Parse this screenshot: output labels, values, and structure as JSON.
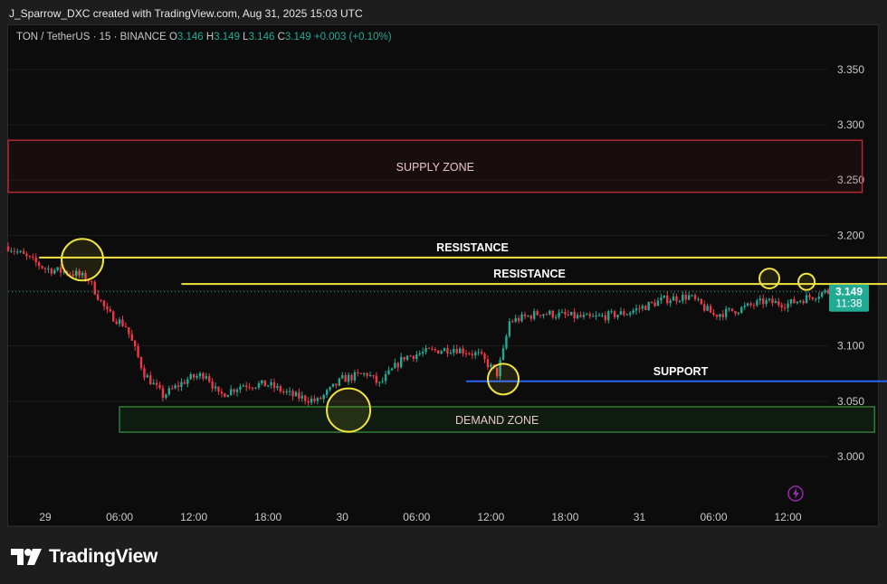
{
  "credit": "J_Sparrow_DXC created with TradingView.com, Aug 31, 2025 15:03 UTC",
  "legend": {
    "symbol": "TON / TetherUS · 15 · BINANCE",
    "o_label": "O",
    "o": "3.146",
    "h_label": "H",
    "h": "3.149",
    "l_label": "L",
    "l": "3.146",
    "c_label": "C",
    "c": "3.149",
    "change": "+0.003 (+0.10%)"
  },
  "price_tag": {
    "price": "3.149",
    "countdown": "11:38"
  },
  "brand": "TradingView",
  "colors": {
    "up": "#22ab94",
    "down": "#f23645",
    "resistance": "#f0e442",
    "support": "#2962ff",
    "supply": "#b22833",
    "demand": "#2e7d32",
    "tag": "#22ab94"
  },
  "chart_data": {
    "type": "candlestick",
    "y_ticks": [
      "3.350",
      "3.300",
      "3.250",
      "3.200",
      "3.150",
      "3.100",
      "3.050",
      "3.000"
    ],
    "y_tick_values": [
      3.35,
      3.3,
      3.25,
      3.2,
      3.15,
      3.1,
      3.05,
      3.0
    ],
    "ylim": [
      2.955,
      3.39
    ],
    "x_ticks": [
      "29",
      "06:00",
      "12:00",
      "18:00",
      "30",
      "06:00",
      "12:00",
      "18:00",
      "31",
      "06:00",
      "12:00"
    ],
    "x_start": "2025-08-28 21:00 UTC",
    "x_end": "2025-08-31 15:15 UTC",
    "interval": "15m",
    "trend_path": [
      {
        "t": "2025-08-28 21:00",
        "p": 3.19
      },
      {
        "t": "2025-08-29 00:00",
        "p": 3.17
      },
      {
        "t": "2025-08-29 02:30",
        "p": 3.165
      },
      {
        "t": "2025-08-29 03:30",
        "p": 3.16
      },
      {
        "t": "2025-08-29 05:00",
        "p": 3.13
      },
      {
        "t": "2025-08-29 06:30",
        "p": 3.118
      },
      {
        "t": "2025-08-29 08:00",
        "p": 3.075
      },
      {
        "t": "2025-08-29 09:30",
        "p": 3.055
      },
      {
        "t": "2025-08-29 11:30",
        "p": 3.07
      },
      {
        "t": "2025-08-29 13:00",
        "p": 3.075
      },
      {
        "t": "2025-08-29 14:00",
        "p": 3.055
      },
      {
        "t": "2025-08-29 16:00",
        "p": 3.065
      },
      {
        "t": "2025-08-29 18:00",
        "p": 3.065
      },
      {
        "t": "2025-08-29 20:00",
        "p": 3.055
      },
      {
        "t": "2025-08-29 22:00",
        "p": 3.05
      },
      {
        "t": "2025-08-30 00:00",
        "p": 3.07
      },
      {
        "t": "2025-08-30 02:00",
        "p": 3.075
      },
      {
        "t": "2025-08-30 03:00",
        "p": 3.065
      },
      {
        "t": "2025-08-30 04:00",
        "p": 3.078
      },
      {
        "t": "2025-08-30 05:00",
        "p": 3.09
      },
      {
        "t": "2025-08-30 07:00",
        "p": 3.095
      },
      {
        "t": "2025-08-30 09:00",
        "p": 3.098
      },
      {
        "t": "2025-08-30 11:00",
        "p": 3.092
      },
      {
        "t": "2025-08-30 12:30",
        "p": 3.075
      },
      {
        "t": "2025-08-30 13:00",
        "p": 3.095
      },
      {
        "t": "2025-08-30 13:30",
        "p": 3.122
      },
      {
        "t": "2025-08-30 16:00",
        "p": 3.13
      },
      {
        "t": "2025-08-30 20:00",
        "p": 3.125
      },
      {
        "t": "2025-08-30 23:00",
        "p": 3.13
      },
      {
        "t": "2025-08-31 02:00",
        "p": 3.142
      },
      {
        "t": "2025-08-31 04:00",
        "p": 3.145
      },
      {
        "t": "2025-08-31 06:00",
        "p": 3.128
      },
      {
        "t": "2025-08-31 08:00",
        "p": 3.133
      },
      {
        "t": "2025-08-31 10:00",
        "p": 3.14
      },
      {
        "t": "2025-08-31 12:00",
        "p": 3.138
      },
      {
        "t": "2025-08-31 15:00",
        "p": 3.149
      }
    ],
    "zones": [
      {
        "label": "SUPPLY ZONE",
        "low": 3.239,
        "high": 3.286,
        "from": "2025-08-28 21:00",
        "to": "2025-08-31 18:00"
      },
      {
        "label": "DEMAND ZONE",
        "low": 3.022,
        "high": 3.045,
        "from": "2025-08-29 06:00",
        "to": "2025-08-31 19:00"
      }
    ],
    "levels": [
      {
        "label": "RESISTANCE",
        "price": 3.18,
        "from": "2025-08-28 23:30",
        "to": "2025-08-31 20:00"
      },
      {
        "label": "RESISTANCE",
        "price": 3.156,
        "from": "2025-08-29 11:00",
        "to": "2025-08-31 20:00"
      },
      {
        "label": "SUPPORT",
        "price": 3.068,
        "from": "2025-08-30 10:00",
        "to": "2025-08-31 20:00"
      }
    ],
    "circled_points": [
      {
        "t": "2025-08-29 03:00",
        "p": 3.178
      },
      {
        "t": "2025-08-30 00:30",
        "p": 3.042
      },
      {
        "t": "2025-08-30 13:00",
        "p": 3.07
      },
      {
        "t": "2025-08-31 10:30",
        "p": 3.161
      },
      {
        "t": "2025-08-31 13:30",
        "p": 3.158
      }
    ]
  }
}
